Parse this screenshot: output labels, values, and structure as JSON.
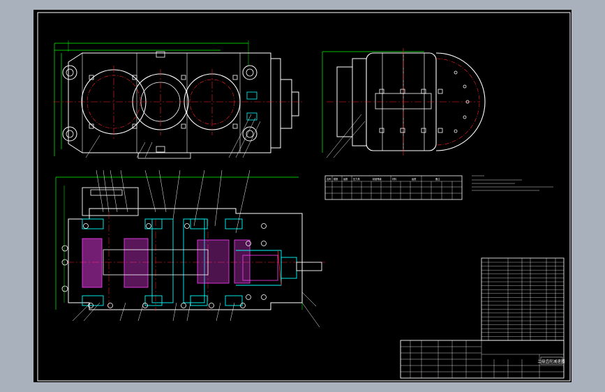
{
  "drawing": {
    "title_block": {
      "title_text": "二级齿轮减速器"
    },
    "gear_table": {
      "headers": [
        "名称",
        "模数",
        "齿数",
        "压力角",
        "精度等级",
        "材料",
        "齿宽",
        "备注"
      ]
    }
  },
  "colors": {
    "background": "#000000",
    "border": "#ffffff",
    "outline": "#ffffff",
    "dimension": "#00ff00",
    "centerline": "#ff2020",
    "section": "#00ffff",
    "hatch": "#ff40ff",
    "note": "#ffff00"
  }
}
